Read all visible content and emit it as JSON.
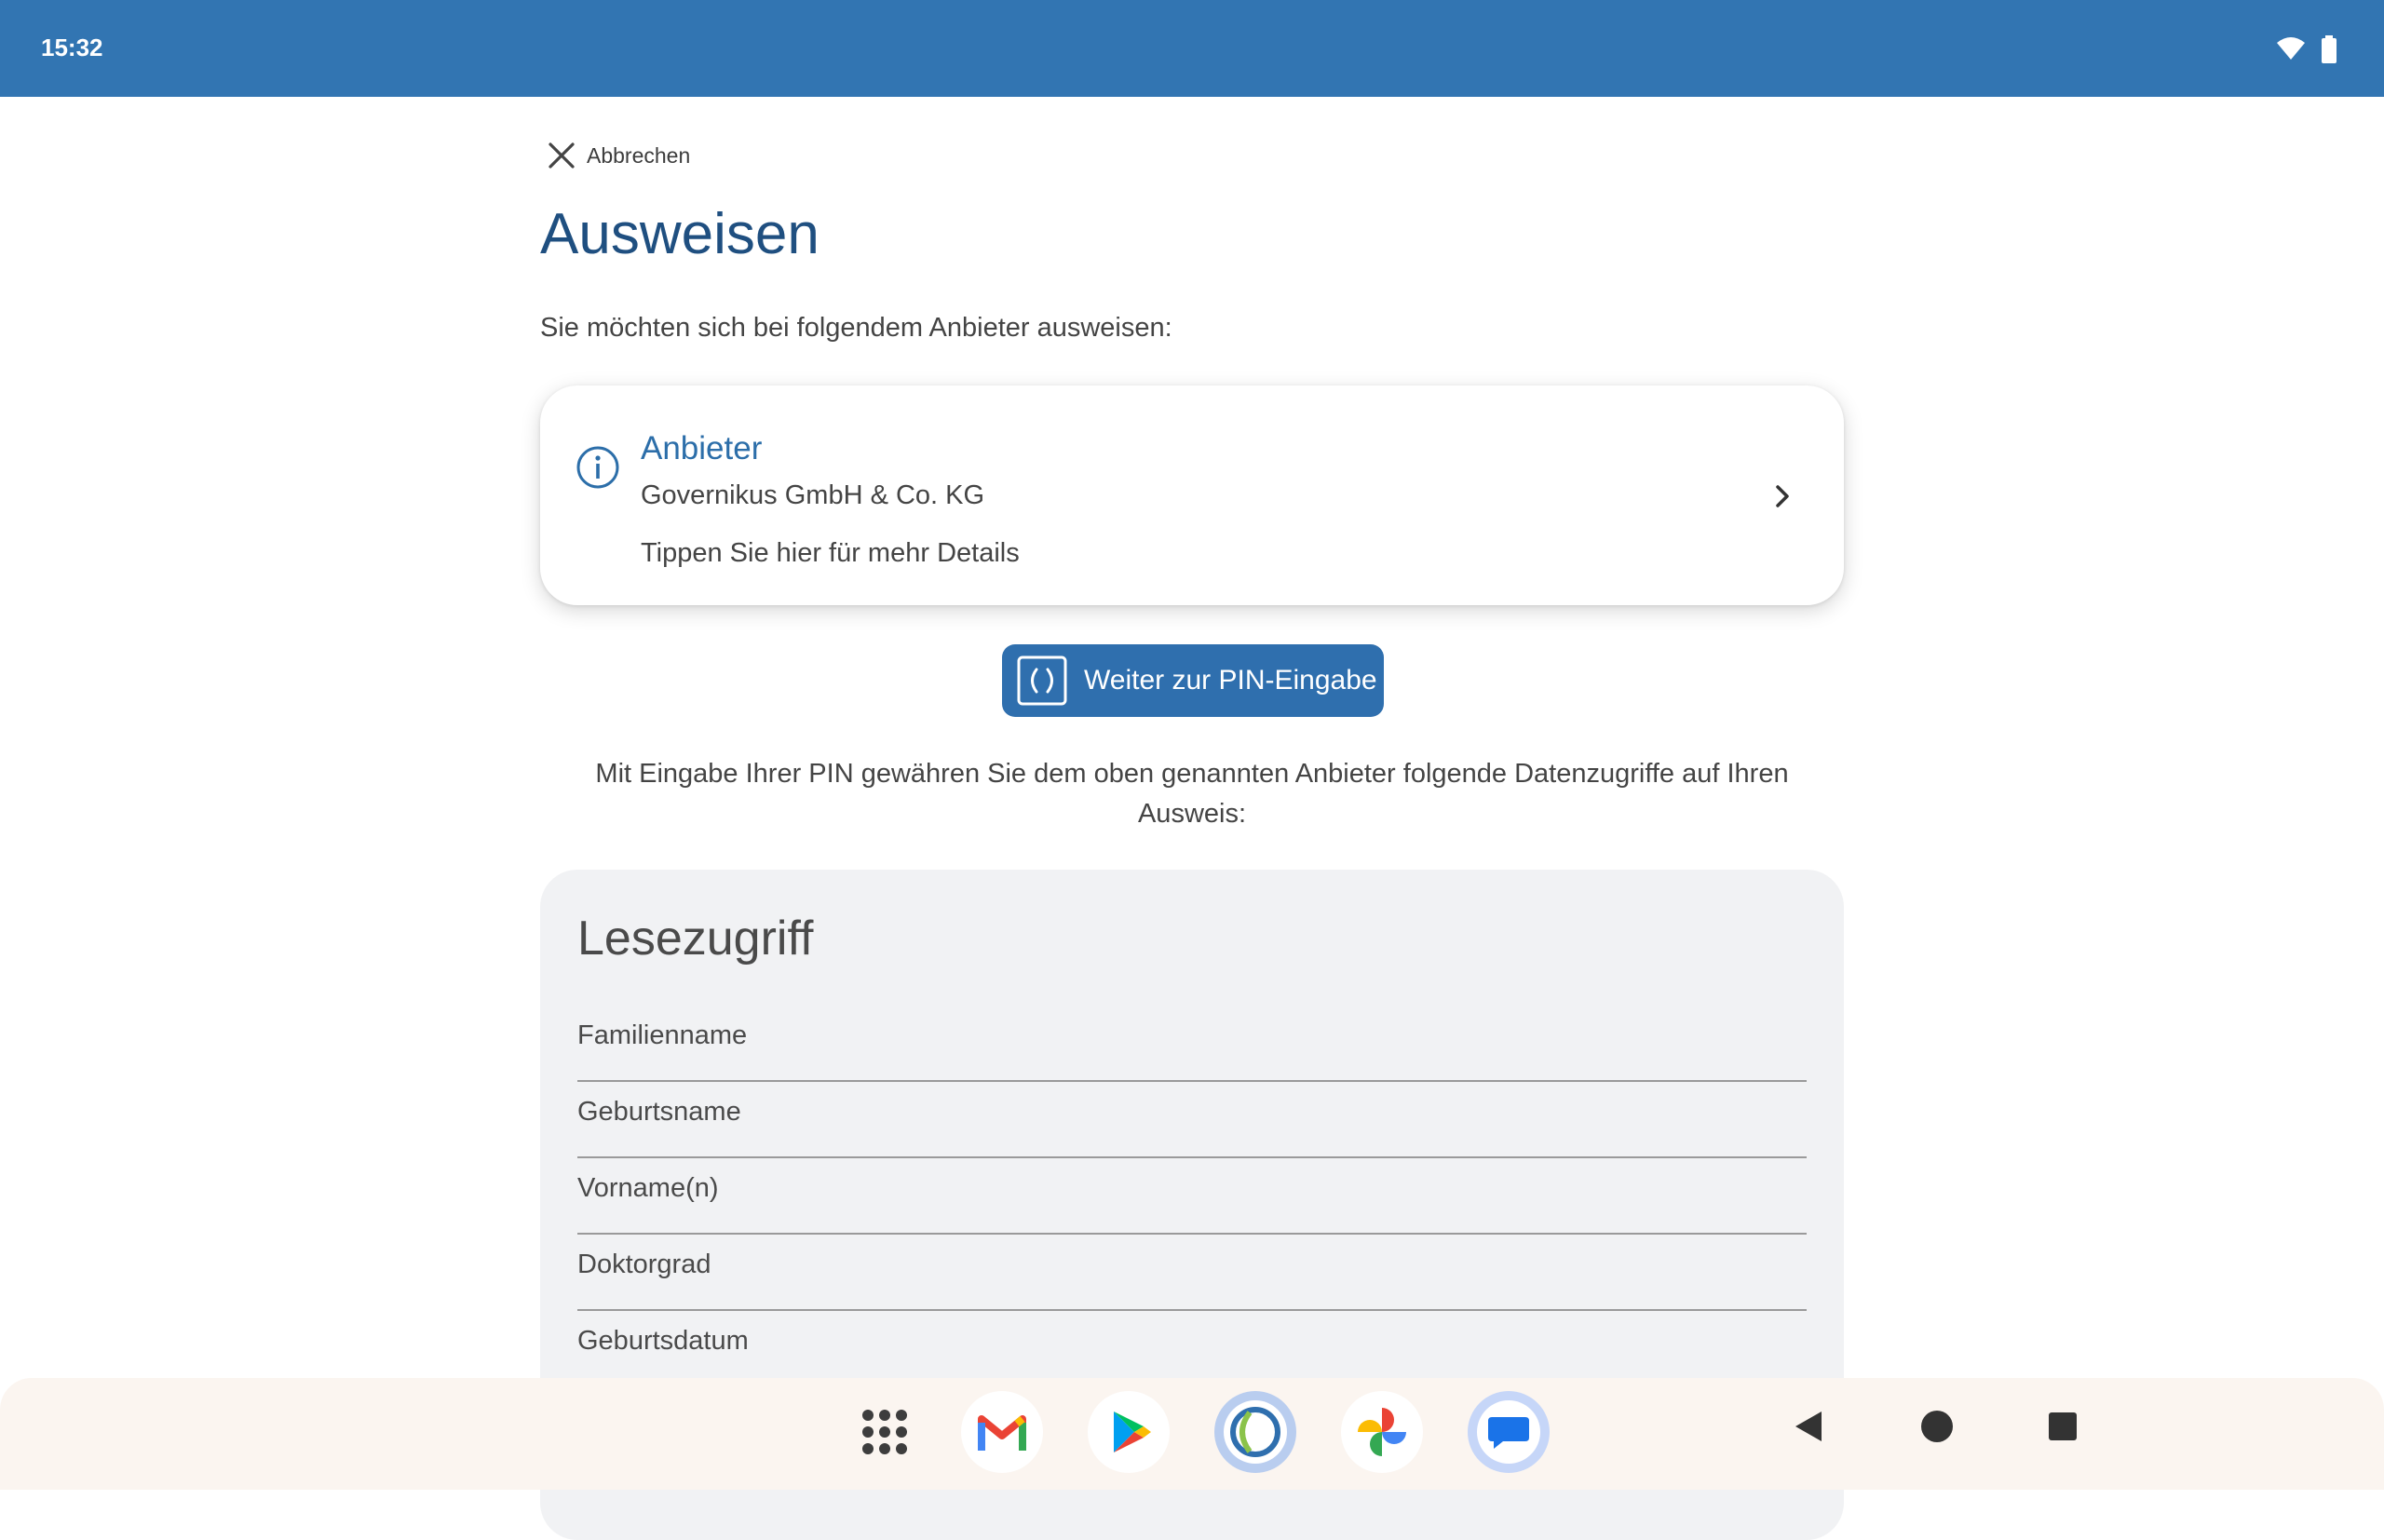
{
  "status_bar": {
    "time": "15:32"
  },
  "header": {
    "cancel_label": "Abbrechen",
    "title": "Ausweisen",
    "subtitle": "Sie möchten sich bei folgendem Anbieter ausweisen:"
  },
  "provider_card": {
    "label": "Anbieter",
    "name": "Governikus GmbH & Co. KG",
    "hint": "Tippen Sie hier für mehr Details",
    "icon": "info-icon"
  },
  "pin_button": {
    "label": "Weiter zur PIN-Eingabe",
    "icon": "pin-entry-icon"
  },
  "consent_text": "Mit Eingabe Ihrer PIN gewähren Sie dem oben genannten Anbieter folgende Datenzugriffe auf Ihren Ausweis:",
  "read_access": {
    "title": "Lesezugriff",
    "items": [
      "Familienname",
      "Geburtsname",
      "Vorname(n)",
      "Doktorgrad",
      "Geburtsdatum"
    ]
  },
  "taskbar": {
    "apps": [
      "app-drawer-icon",
      "gmail-icon",
      "play-store-icon",
      "ausweisapp-icon",
      "photos-icon",
      "messages-icon"
    ],
    "nav": [
      "back-icon",
      "home-icon",
      "recents-icon"
    ]
  },
  "colors": {
    "status_bar": "#3275b2",
    "accent": "#2f6fae",
    "title": "#1f4f80",
    "card_bg": "#f1f2f4"
  }
}
